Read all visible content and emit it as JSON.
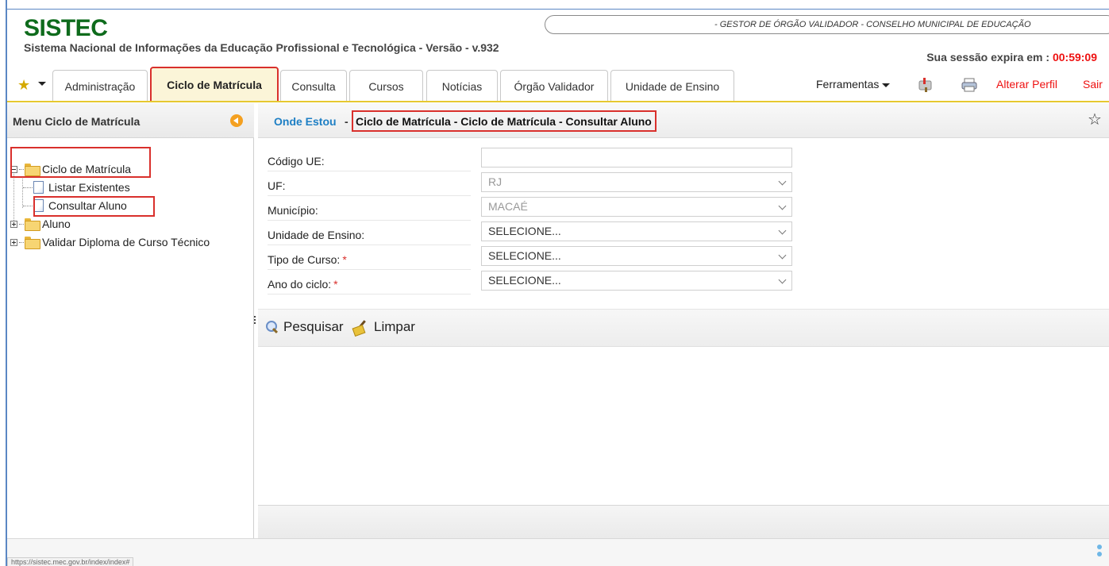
{
  "header": {
    "brand": "SISTEC",
    "subtitle": "Sistema Nacional de Informações da Educação Profissional e Tecnológica - Versão - v.932",
    "profile": "- GESTOR DE ÓRGÃO VALIDADOR - CONSELHO MUNICIPAL DE EDUCAÇÃO",
    "session_label": "Sua sessão expira em :",
    "session_time": "00:59:09"
  },
  "tabs": [
    {
      "label": "Administração"
    },
    {
      "label": "Ciclo de Matrícula",
      "active": true
    },
    {
      "label": "Consulta"
    },
    {
      "label": "Cursos"
    },
    {
      "label": "Notícias"
    },
    {
      "label": "Órgão Validador"
    },
    {
      "label": "Unidade de Ensino"
    }
  ],
  "toolbar": {
    "tools_label": "Ferramentas",
    "alterar_perfil": "Alterar Perfil",
    "sair": "Sair"
  },
  "sidebar": {
    "title": "Menu Ciclo de Matrícula",
    "tree": [
      {
        "label": "Ciclo de Matrícula",
        "expanded": true
      },
      {
        "label": "Listar Existentes"
      },
      {
        "label": "Consultar Aluno",
        "selected": true
      },
      {
        "label": "Aluno",
        "expanded": false
      },
      {
        "label": "Validar Diploma de Curso Técnico",
        "expanded": false
      }
    ]
  },
  "breadcrumb": {
    "label": "Onde Estou",
    "separator": "-",
    "path": "Ciclo de Matrícula - Ciclo de Matrícula - Consultar Aluno"
  },
  "form": {
    "fields": [
      {
        "label": "Código UE:",
        "value": "",
        "required": false
      },
      {
        "label": "UF:",
        "value": "RJ",
        "required": false
      },
      {
        "label": "Município:",
        "value": "MACAÉ",
        "required": false
      },
      {
        "label": "Unidade de Ensino:",
        "value": "SELECIONE...",
        "required": false
      },
      {
        "label": "Tipo de Curso:",
        "value": "SELECIONE...",
        "required": true
      },
      {
        "label": "Ano do ciclo:",
        "value": "SELECIONE...",
        "required": true
      }
    ],
    "required_mark": "*"
  },
  "actions": {
    "search": "Pesquisar",
    "clear": "Limpar"
  },
  "status_bar": {
    "url": "https://sistec.mec.gov.br/index/index#"
  },
  "colors": {
    "brand": "#0e6b1c",
    "highlight": "#d9302c",
    "breadcrumb_label": "#1e7fc4",
    "active_tab_bg": "#fbf5d8"
  }
}
